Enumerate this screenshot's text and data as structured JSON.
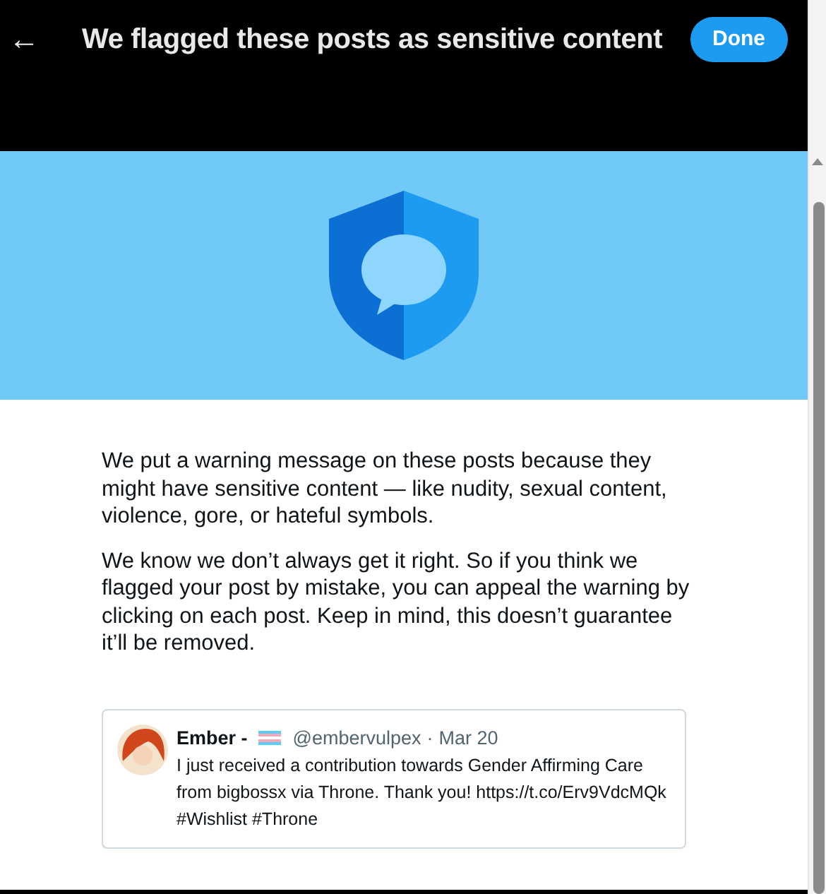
{
  "header": {
    "back_icon": "←",
    "title": "We flagged these posts as sensitive content",
    "done_button": "Done"
  },
  "paragraphs": [
    "We put a warning message on these posts because they might have sensitive content — like nudity, sexual content, violence, gore, or hateful symbols.",
    "We know we don’t always get it right. So if you think we flagged your post by mistake, you can appeal the warning by clicking on each post. Keep in mind, this doesn’t guarantee it’ll be removed."
  ],
  "posts": [
    {
      "name": "Ember -",
      "handle": "@embervulpex",
      "separator": "·",
      "date": "Mar 20",
      "text": "I just received a contribution towards Gender Affirming Care from bigbossx via Throne. Thank you! https://t.co/Erv9VdcMQk #Wishlist #Throne"
    }
  ]
}
